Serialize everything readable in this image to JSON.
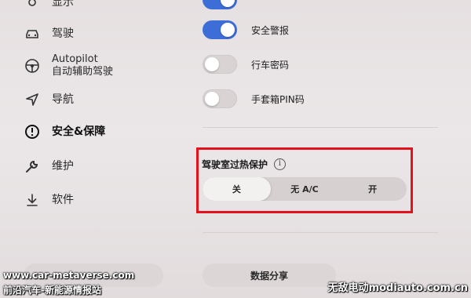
{
  "sidebar": {
    "items": [
      {
        "label": "显示",
        "icon": "display-icon"
      },
      {
        "label": "驾驶",
        "icon": "car-icon"
      },
      {
        "label_line1": "Autopilot",
        "label_line2": "自动辅助驾驶",
        "icon": "steering-wheel-icon"
      },
      {
        "label": "导航",
        "icon": "navigation-icon"
      },
      {
        "label": "安全&保障",
        "icon": "alert-icon",
        "active": true
      },
      {
        "label": "维护",
        "icon": "wrench-icon"
      },
      {
        "label": "软件",
        "icon": "download-icon"
      }
    ]
  },
  "toggles": [
    {
      "label": "安全警报",
      "on": true
    },
    {
      "label": "行车密码",
      "on": false
    },
    {
      "label": "手套箱PIN码",
      "on": false
    }
  ],
  "overheat": {
    "title": "驾驶室过热保护",
    "options": [
      "关",
      "无 A/C",
      "开"
    ],
    "selected": "关"
  },
  "data_share": {
    "label": "数据分享"
  },
  "watermarks": {
    "site1": "www.car-metaverse.com",
    "site1_sub": "前沿汽车-新能源情报站",
    "site2": "无敌电动modiauto.com.cn"
  },
  "colors": {
    "accent": "#3d6ed8",
    "highlight": "#e4121d"
  }
}
